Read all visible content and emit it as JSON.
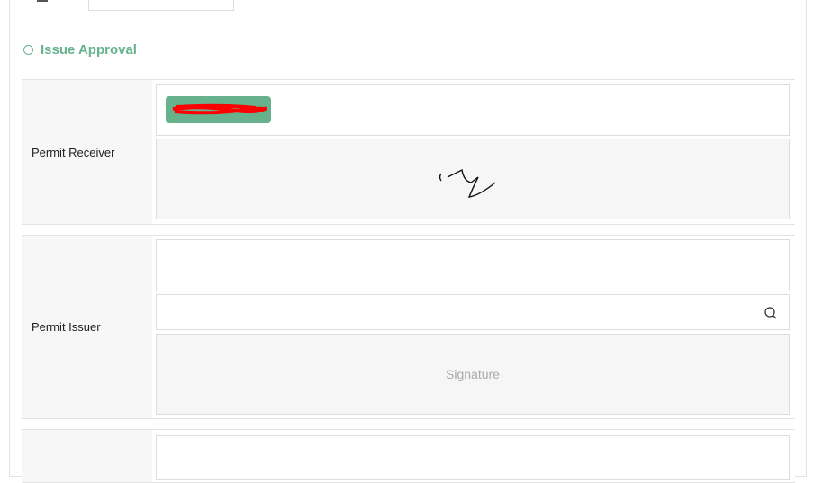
{
  "section": {
    "title": "Issue Approval"
  },
  "rows": [
    {
      "label": "Permit Receiver"
    },
    {
      "label": "Permit Issuer",
      "signature_placeholder": "Signature"
    }
  ],
  "colors": {
    "accent": "#67b28d",
    "redaction": "#ff0000"
  }
}
